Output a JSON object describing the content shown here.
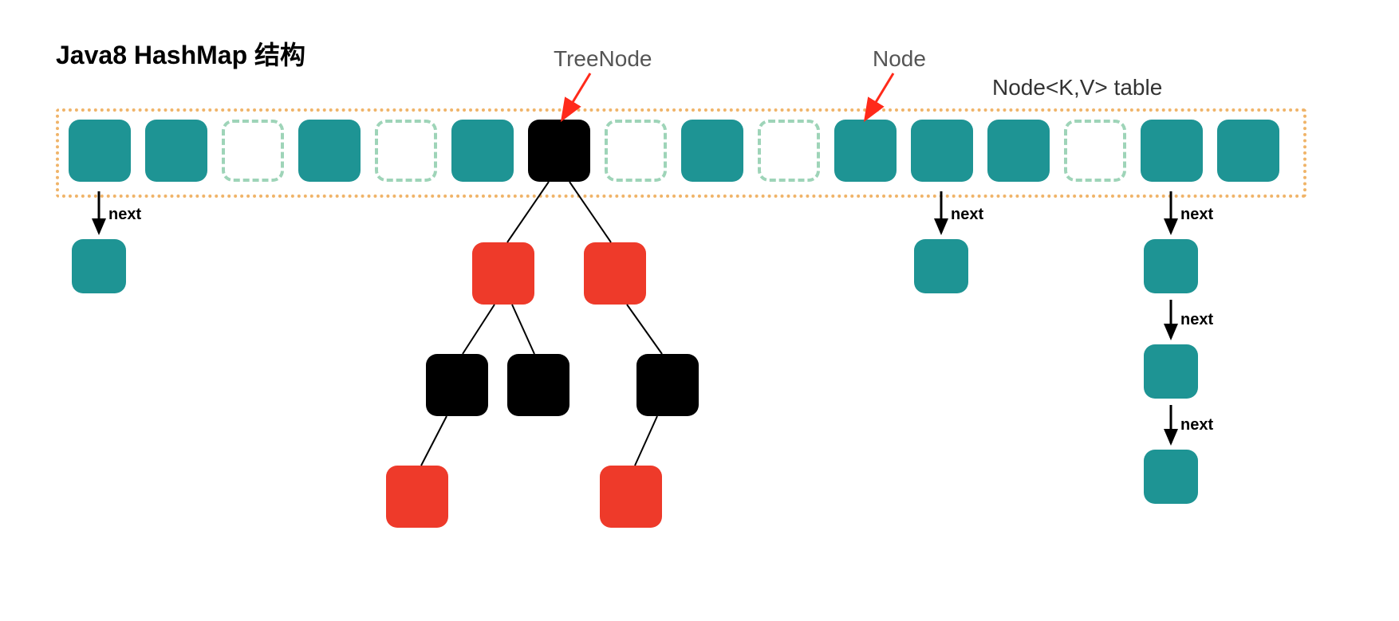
{
  "title": "Java8 HashMap 结构",
  "labels": {
    "treenode": "TreeNode",
    "node": "Node",
    "table": "Node<K,V> table",
    "next": "next"
  },
  "colors": {
    "teal": "#1e9494",
    "black": "#000000",
    "red": "#ee3a2a",
    "dashedGreen": "#9ed4b8",
    "tableBorder": "#f0b469",
    "arrowRed": "#ff2a1a"
  },
  "table": {
    "slots": [
      {
        "type": "filled"
      },
      {
        "type": "filled"
      },
      {
        "type": "empty"
      },
      {
        "type": "filled"
      },
      {
        "type": "empty"
      },
      {
        "type": "filled"
      },
      {
        "type": "tree-black"
      },
      {
        "type": "empty"
      },
      {
        "type": "filled"
      },
      {
        "type": "empty"
      },
      {
        "type": "filled"
      },
      {
        "type": "filled"
      },
      {
        "type": "filled"
      },
      {
        "type": "empty"
      },
      {
        "type": "filled"
      },
      {
        "type": "filled"
      }
    ]
  },
  "chains": [
    {
      "fromSlot": 0,
      "nodes": 1
    },
    {
      "fromSlot": 11,
      "nodes": 1
    },
    {
      "fromSlot": 14,
      "nodes": 3
    }
  ],
  "tree": {
    "rootSlot": 6,
    "level1": [
      {
        "color": "red"
      },
      {
        "color": "red"
      }
    ],
    "level2": [
      {
        "parent": 0,
        "side": "left",
        "color": "black"
      },
      {
        "parent": 0,
        "side": "right",
        "color": "black"
      },
      {
        "parent": 1,
        "side": "right",
        "color": "black"
      }
    ],
    "level3": [
      {
        "parent": 0,
        "side": "left",
        "color": "red"
      },
      {
        "parent": 2,
        "side": "left",
        "color": "red"
      }
    ]
  }
}
